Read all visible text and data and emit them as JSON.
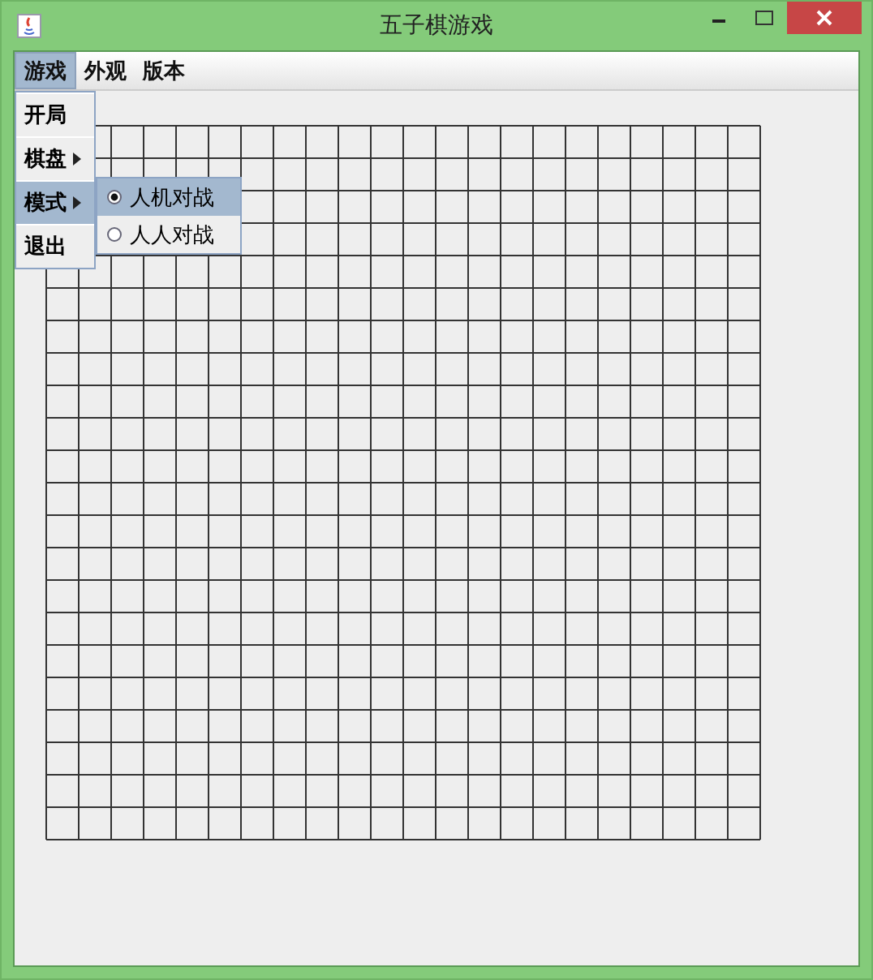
{
  "window": {
    "title": "五子棋游戏"
  },
  "menubar": [
    {
      "label": "游戏",
      "selected": true
    },
    {
      "label": "外观",
      "selected": false
    },
    {
      "label": "版本",
      "selected": false
    }
  ],
  "open_menu": {
    "items": [
      {
        "kind": "item",
        "label": "开局",
        "selected": false
      },
      {
        "kind": "submenu",
        "label": "棋盘",
        "selected": false
      },
      {
        "kind": "submenu",
        "label": "模式",
        "selected": true
      },
      {
        "kind": "item",
        "label": "退出",
        "selected": false
      }
    ]
  },
  "submenu": {
    "items": [
      {
        "label": "人机对战",
        "checked": true,
        "selected": true
      },
      {
        "label": "人人对战",
        "checked": false,
        "selected": false
      }
    ]
  }
}
